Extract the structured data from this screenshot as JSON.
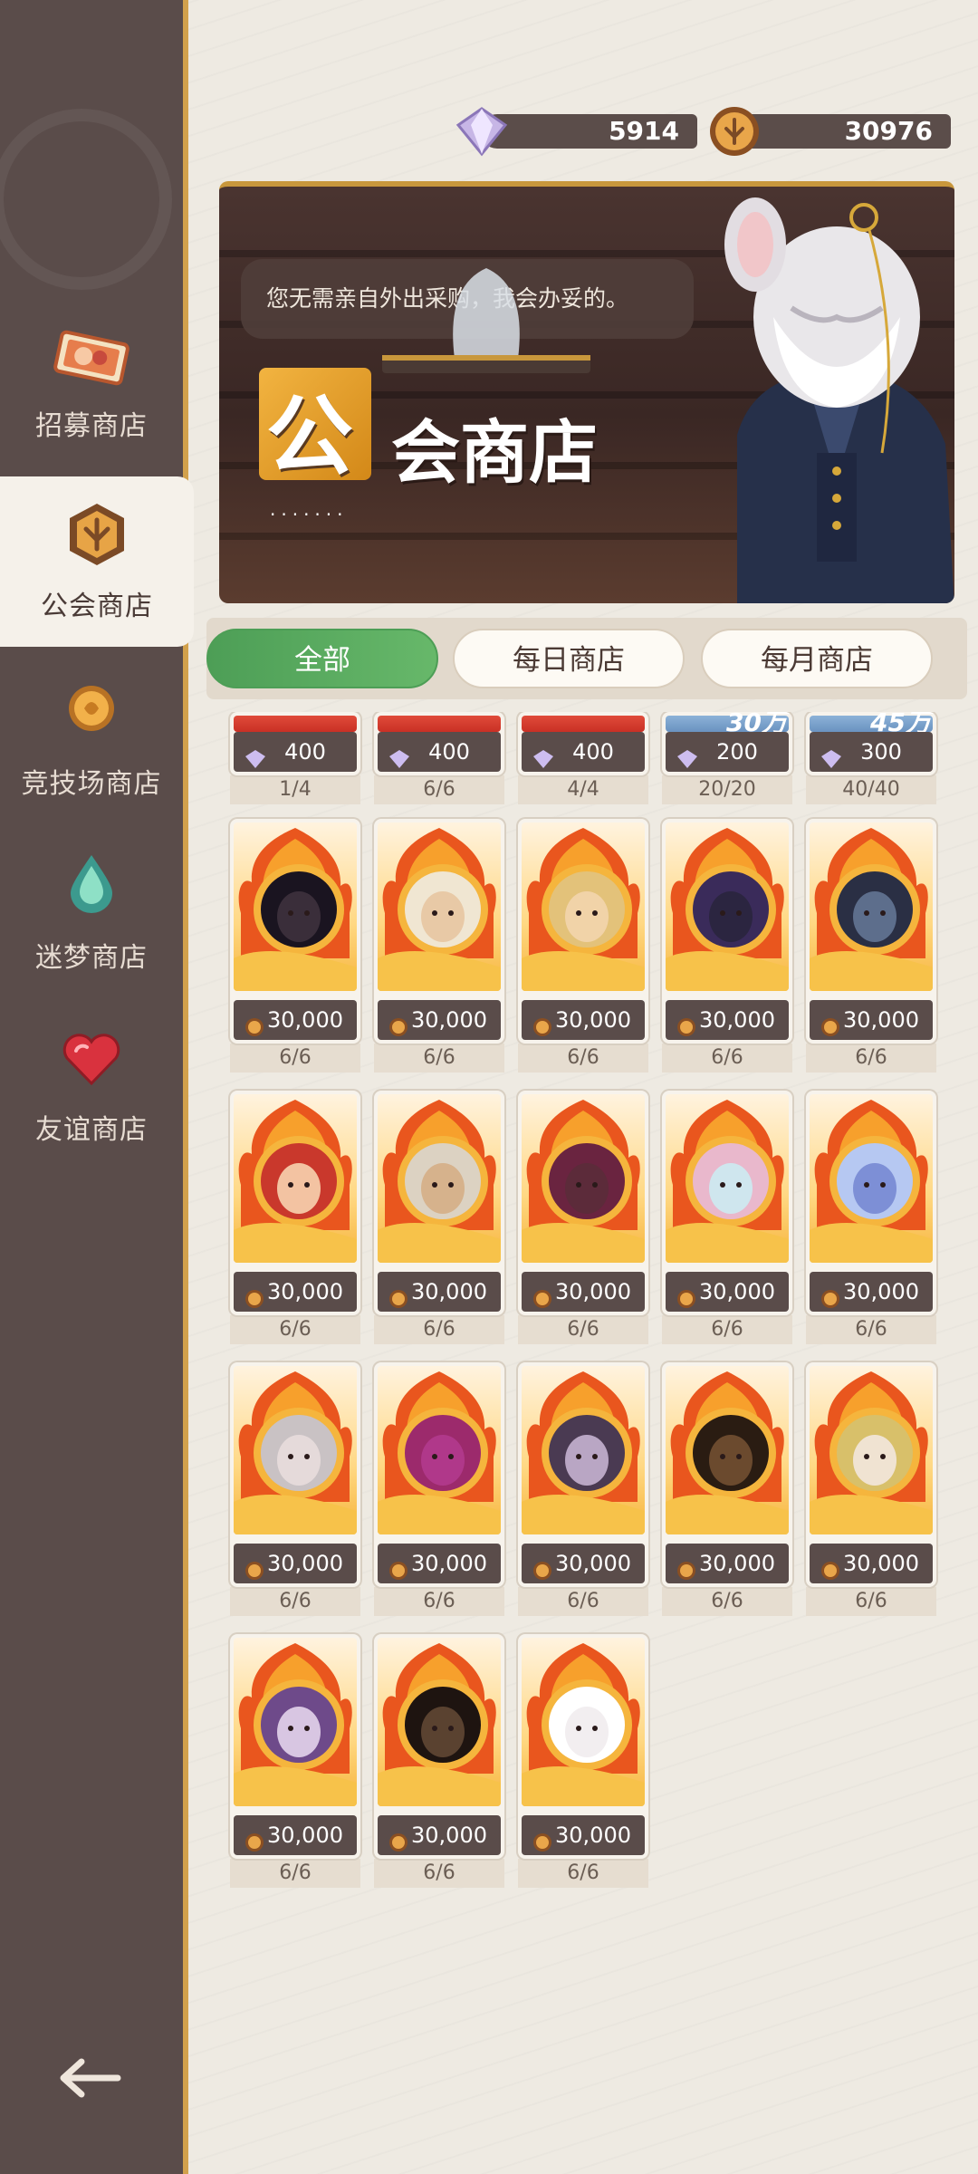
{
  "currency": {
    "gems": "5914",
    "guild_coins": "30976"
  },
  "sidebar": {
    "items": [
      {
        "label": "招募商店",
        "icon": "recruit-ticket-icon"
      },
      {
        "label": "公会商店",
        "icon": "guild-badge-icon",
        "active": true
      },
      {
        "label": "竞技场商店",
        "icon": "arena-coin-icon"
      },
      {
        "label": "迷梦商店",
        "icon": "dream-drop-icon"
      },
      {
        "label": "友谊商店",
        "icon": "heart-icon"
      }
    ],
    "back_icon": "back-arrow-icon"
  },
  "banner": {
    "speech": "您无需亲自外出采购，我会办妥的。",
    "title_first": "公",
    "title_rest": "会商店",
    "dots": "·······"
  },
  "tabs": [
    {
      "label": "全部",
      "active": true
    },
    {
      "label": "每日商店"
    },
    {
      "label": "每月商店"
    }
  ],
  "top_row": [
    {
      "price": "400",
      "stock": "1/4",
      "ribbon": ""
    },
    {
      "price": "400",
      "stock": "6/6",
      "ribbon": ""
    },
    {
      "price": "400",
      "stock": "4/4",
      "ribbon": ""
    },
    {
      "price": "200",
      "stock": "20/20",
      "ribbon": "30万"
    },
    {
      "price": "300",
      "stock": "40/40",
      "ribbon": "45万"
    }
  ],
  "items": [
    {
      "price": "30,000",
      "stock": "6/6"
    },
    {
      "price": "30,000",
      "stock": "6/6"
    },
    {
      "price": "30,000",
      "stock": "6/6"
    },
    {
      "price": "30,000",
      "stock": "6/6"
    },
    {
      "price": "30,000",
      "stock": "6/6"
    },
    {
      "price": "30,000",
      "stock": "6/6"
    },
    {
      "price": "30,000",
      "stock": "6/6"
    },
    {
      "price": "30,000",
      "stock": "6/6"
    },
    {
      "price": "30,000",
      "stock": "6/6"
    },
    {
      "price": "30,000",
      "stock": "6/6"
    },
    {
      "price": "30,000",
      "stock": "6/6"
    },
    {
      "price": "30,000",
      "stock": "6/6"
    },
    {
      "price": "30,000",
      "stock": "6/6"
    },
    {
      "price": "30,000",
      "stock": "6/6"
    },
    {
      "price": "30,000",
      "stock": "6/6"
    },
    {
      "price": "30,000",
      "stock": "6/6"
    },
    {
      "price": "30,000",
      "stock": "6/6"
    },
    {
      "price": "30,000",
      "stock": "6/6"
    }
  ],
  "colors": {
    "accent_green": "#4d9e56",
    "sidebar_bg": "#5a4c4a",
    "gold": "#d2a14c"
  }
}
